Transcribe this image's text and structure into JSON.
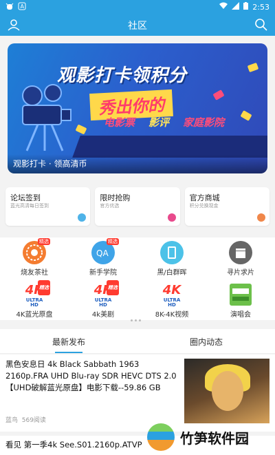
{
  "status_bar": {
    "time": "2:53",
    "left_icons": [
      "bug-icon",
      "a-icon"
    ],
    "right_icons": [
      "wifi-icon",
      "signal-icon",
      "battery-icon"
    ]
  },
  "app_bar": {
    "title": "社区"
  },
  "banner": {
    "headline": "观影打卡领积分",
    "subheadline": "秀出你的",
    "tags": [
      "电影票",
      "影评",
      "家庭影院"
    ],
    "caption": "观影打卡 · 领高清币"
  },
  "quick_cards": [
    {
      "title": "论坛签到",
      "subtitle": "蓝光高清每日签到",
      "color": "#4fb3e8"
    },
    {
      "title": "限时抢购",
      "subtitle": "官方优选",
      "color": "#e84a8c"
    },
    {
      "title": "官方商城",
      "subtitle": "积分兑换现金",
      "color": "#f0874a"
    }
  ],
  "grid": [
    {
      "label": "烧友茶社",
      "badge": "精选",
      "icon": "sofa-icon"
    },
    {
      "label": "新手学院",
      "badge": "精选",
      "icon": "qa-icon"
    },
    {
      "label": "黑/白群晖",
      "badge": "",
      "icon": "nas-icon"
    },
    {
      "label": "寻片求片",
      "badge": "",
      "icon": "clapper-icon"
    },
    {
      "label": "4K蓝光原盘",
      "badge": "精选",
      "icon": "4k-icon"
    },
    {
      "label": "4k美剧",
      "badge": "精选",
      "icon": "4k-icon"
    },
    {
      "label": "8K-4K视频",
      "badge": "",
      "icon": "4k-icon"
    },
    {
      "label": "演唱会",
      "badge": "",
      "icon": "concert-icon"
    }
  ],
  "tabs": [
    "最新发布",
    "圈内动态"
  ],
  "posts": [
    {
      "title": "黑色安息日 4k Black Sabbath 1963 2160p.FRA UHD Blu-ray SDR HEVC DTS 2.0【UHD破解蓝光原盘】电影下载--59.86 GB",
      "author": "蓝鸟",
      "views": "569阅读"
    },
    {
      "title": "看见 第一季4k See.S01.2160p.ATVP"
    }
  ],
  "watermark": {
    "text": "竹笋软件园"
  }
}
